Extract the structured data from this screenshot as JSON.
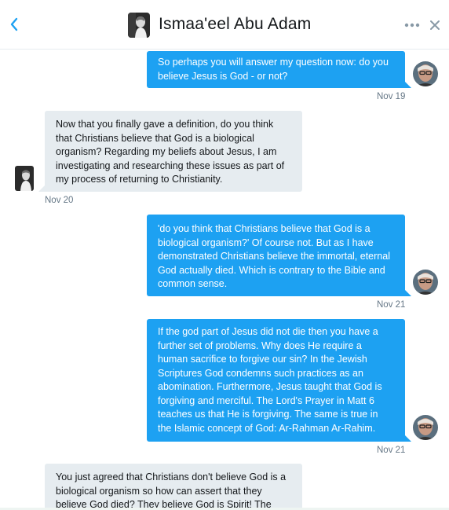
{
  "header": {
    "title": "Ismaa'eel Abu Adam"
  },
  "messages": [
    {
      "direction": "sent",
      "text": "So perhaps you will answer my question now: do you believe Jesus is God - or not?",
      "time": "Nov 19"
    },
    {
      "direction": "received",
      "text": "Now that you finally gave a definition, do you think that Christians believe that God is a biological organism? Regarding my beliefs about Jesus, I am investigating and researching these issues as part of my process of returning to Christianity.",
      "time": "Nov 20"
    },
    {
      "direction": "sent",
      "text": "'do you think that Christians believe that God is a biological organism?' Of course not. But as I have demonstrated Christians believe the immortal, eternal God actually died. Which is contrary to the Bible and common sense.",
      "time": "Nov 21"
    },
    {
      "direction": "sent",
      "text": "If the god part of Jesus did not die then you have a further set of problems. Why does He require a human sacrifice to forgive our sin? In the Jewish Scriptures God condemns such practices as an abomination. Furthermore, Jesus taught that God is forgiving and merciful. The Lord's Prayer in Matt 6 teaches us that He is forgiving. The same is true in the Islamic concept of God: Ar-Rahman Ar-Rahim.",
      "time": "Nov 21"
    },
    {
      "direction": "received",
      "text": "You just agreed that Christians don't believe God is a biological organism so how can assert that they believe God died? They believe God is Spirit! The more",
      "time": ""
    }
  ],
  "colors": {
    "sent_bubble": "#1da1f2",
    "received_bubble": "#e6ecf0",
    "timestamp": "#657786",
    "icon": "#1da1f2"
  },
  "icons": {
    "back": "chevron-left-icon",
    "more": "more-dots-icon",
    "close": "close-icon"
  }
}
